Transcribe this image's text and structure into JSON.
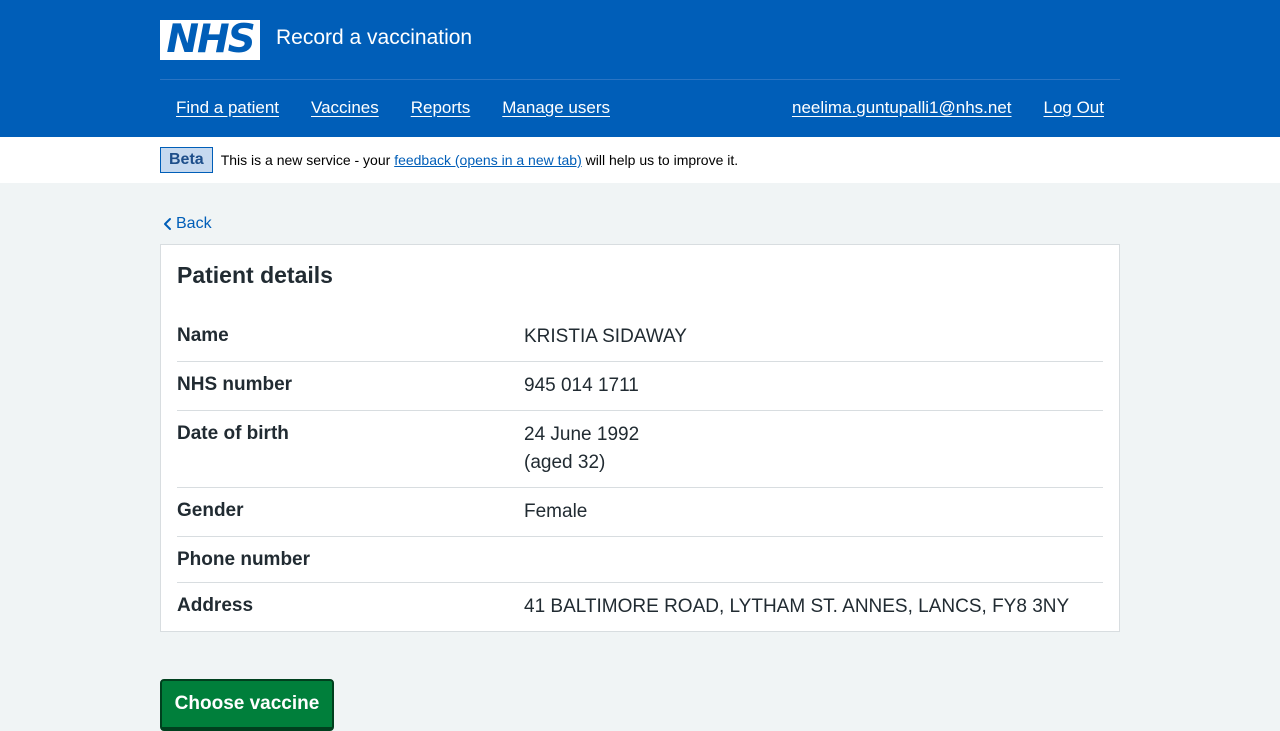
{
  "header": {
    "logo_text": "NHS",
    "service_name": "Record a vaccination",
    "nav": {
      "find_patient": "Find a patient",
      "vaccines": "Vaccines",
      "reports": "Reports",
      "manage_users": "Manage users",
      "user_email": "neelima.guntupalli1@nhs.net",
      "log_out": "Log Out"
    }
  },
  "phase": {
    "tag": "Beta",
    "text_before": "This is a new service - your ",
    "link": "feedback (opens in a new tab)",
    "text_after": " will help us to improve it."
  },
  "back_label": "Back",
  "card": {
    "title": "Patient details",
    "rows": [
      {
        "key": "Name",
        "value": "KRISTIA SIDAWAY"
      },
      {
        "key": "NHS number",
        "value": "945 014 1711"
      },
      {
        "key": "Date of birth",
        "value": "24 June 1992",
        "value2": "(aged 32)"
      },
      {
        "key": "Gender",
        "value": "Female"
      },
      {
        "key": "Phone number",
        "value": ""
      },
      {
        "key": "Address",
        "value": "41 BALTIMORE ROAD, LYTHAM ST. ANNES, LANCS, FY8 3NY"
      }
    ]
  },
  "button_label": "Choose vaccine",
  "colors": {
    "nhs_blue": "#005eb8",
    "background": "#f0f4f5",
    "button_green": "#007f3b"
  }
}
